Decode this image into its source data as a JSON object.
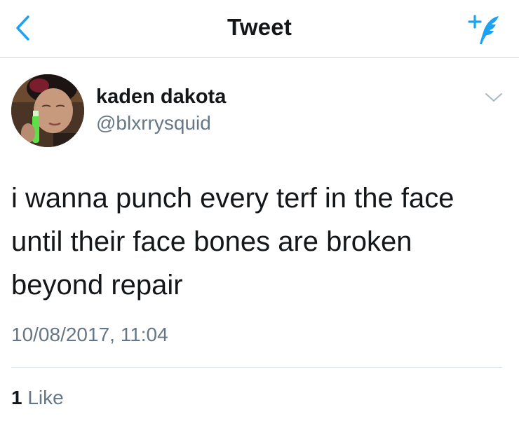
{
  "colors": {
    "accent": "#1da1f2",
    "text_primary": "#14171a",
    "text_secondary": "#657786",
    "divider": "#e1e8ed"
  },
  "navbar": {
    "title": "Tweet",
    "back_icon": "chevron-left-icon",
    "compose_icon": "compose-tweet-icon"
  },
  "tweet": {
    "author": {
      "display_name": "kaden dakota",
      "handle": "@blxrrysquid"
    },
    "menu_icon": "chevron-down-icon",
    "text": "i wanna punch every terf in the face\nuntil their face bones are broken\nbeyond repair",
    "timestamp": "10/08/2017, 11:04",
    "likes": {
      "count": "1",
      "label": "Like"
    }
  }
}
